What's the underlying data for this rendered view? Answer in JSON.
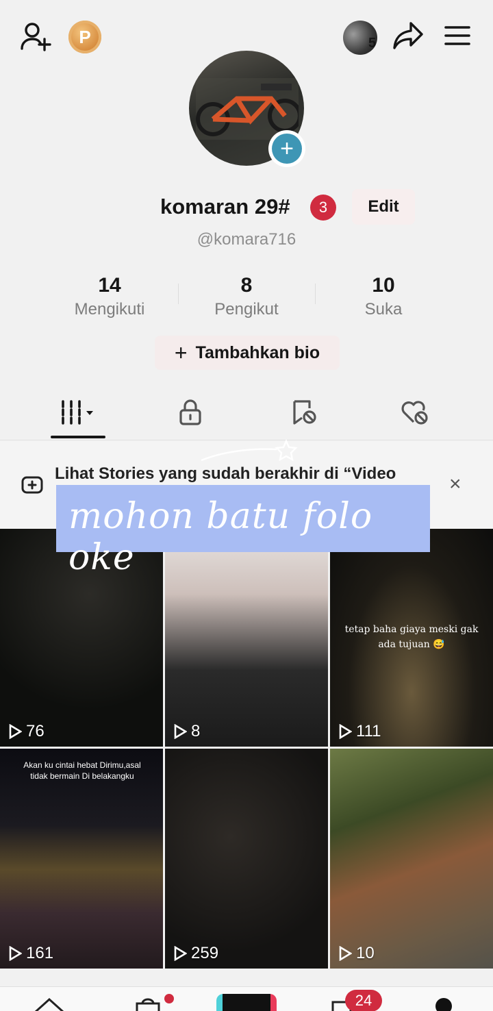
{
  "header": {
    "add_friend_icon": "person-plus-icon",
    "coin_label": "P",
    "stories_count": "5",
    "share_icon": "share-arrow-icon",
    "menu_icon": "hamburger-menu-icon"
  },
  "profile": {
    "name": "komaran 29#",
    "notification_badge": "3",
    "edit_label": "Edit",
    "handle": "@komara716",
    "stats": [
      {
        "value": "14",
        "label": "Mengikuti"
      },
      {
        "value": "8",
        "label": "Pengikut"
      },
      {
        "value": "10",
        "label": "Suka"
      }
    ],
    "bio_button": "Tambahkan bio"
  },
  "tabs": [
    {
      "icon": "video-grid-icon"
    },
    {
      "icon": "lock-icon"
    },
    {
      "icon": "saved-bookmark-icon"
    },
    {
      "icon": "liked-heart-icon"
    }
  ],
  "story_banner": {
    "text": "Lihat Stories yang sudah berakhir di “Video",
    "close_label": "×"
  },
  "overlay_text": "mohon batu folo oke",
  "videos": [
    {
      "views": "76",
      "caption": ""
    },
    {
      "views": "8",
      "caption": ""
    },
    {
      "views": "111",
      "caption": "tetap baha giaya meski gak ada tujuan 😅"
    },
    {
      "views": "161",
      "caption": "Akan ku cintai hebat Dirimu,asal tidak bermain Di belakangku"
    },
    {
      "views": "259",
      "caption": ""
    },
    {
      "views": "10",
      "caption": ""
    }
  ],
  "bottom_nav": {
    "inbox_badge": "24"
  },
  "colors": {
    "accent_blue": "#3e96b5",
    "badge_red": "#d02b3f",
    "overlay_blue": "#a8bcf3"
  }
}
